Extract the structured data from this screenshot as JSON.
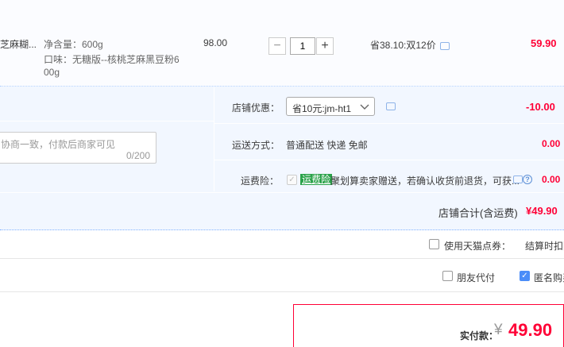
{
  "item": {
    "title_fragment": "芝麻糊...",
    "spec_weight": "净含量：600g",
    "spec_flavor_1": "口味：无糖版--核桃芝麻黑豆粉6",
    "spec_flavor_2": "00g",
    "unit_price": "98.00",
    "quantity": "1",
    "qty_minus": "−",
    "qty_plus": "+",
    "promo": "省38.10:双12价",
    "subtotal": "59.90"
  },
  "shop": {
    "message_placeholder": "协商一致，付款后商家可见",
    "message_counter": "0/200",
    "discount_label": "店铺优惠：",
    "discount_selected": "省10元:jm-ht1",
    "discount_amount": "-10.00",
    "shipping_label": "运送方式：",
    "shipping_value": "普通配送 快递 免邮",
    "shipping_amount": "0.00",
    "insurance_label": "运费险：",
    "insurance_badge": "运费险",
    "insurance_text": "聚划算卖家赠送，若确认收货前退货，可获...",
    "insurance_amount": "0.00",
    "total_label": "店铺合计(含运费)",
    "total_amount": "¥49.90"
  },
  "options": {
    "tmall_points_label": "使用天猫点券：",
    "tmall_points_note": "结算时扣除",
    "friend_pay_label": "朋友代付",
    "anonymous_label": "匿名购买"
  },
  "payment": {
    "label": "实付款：",
    "currency": "¥",
    "amount": "49.90"
  }
}
